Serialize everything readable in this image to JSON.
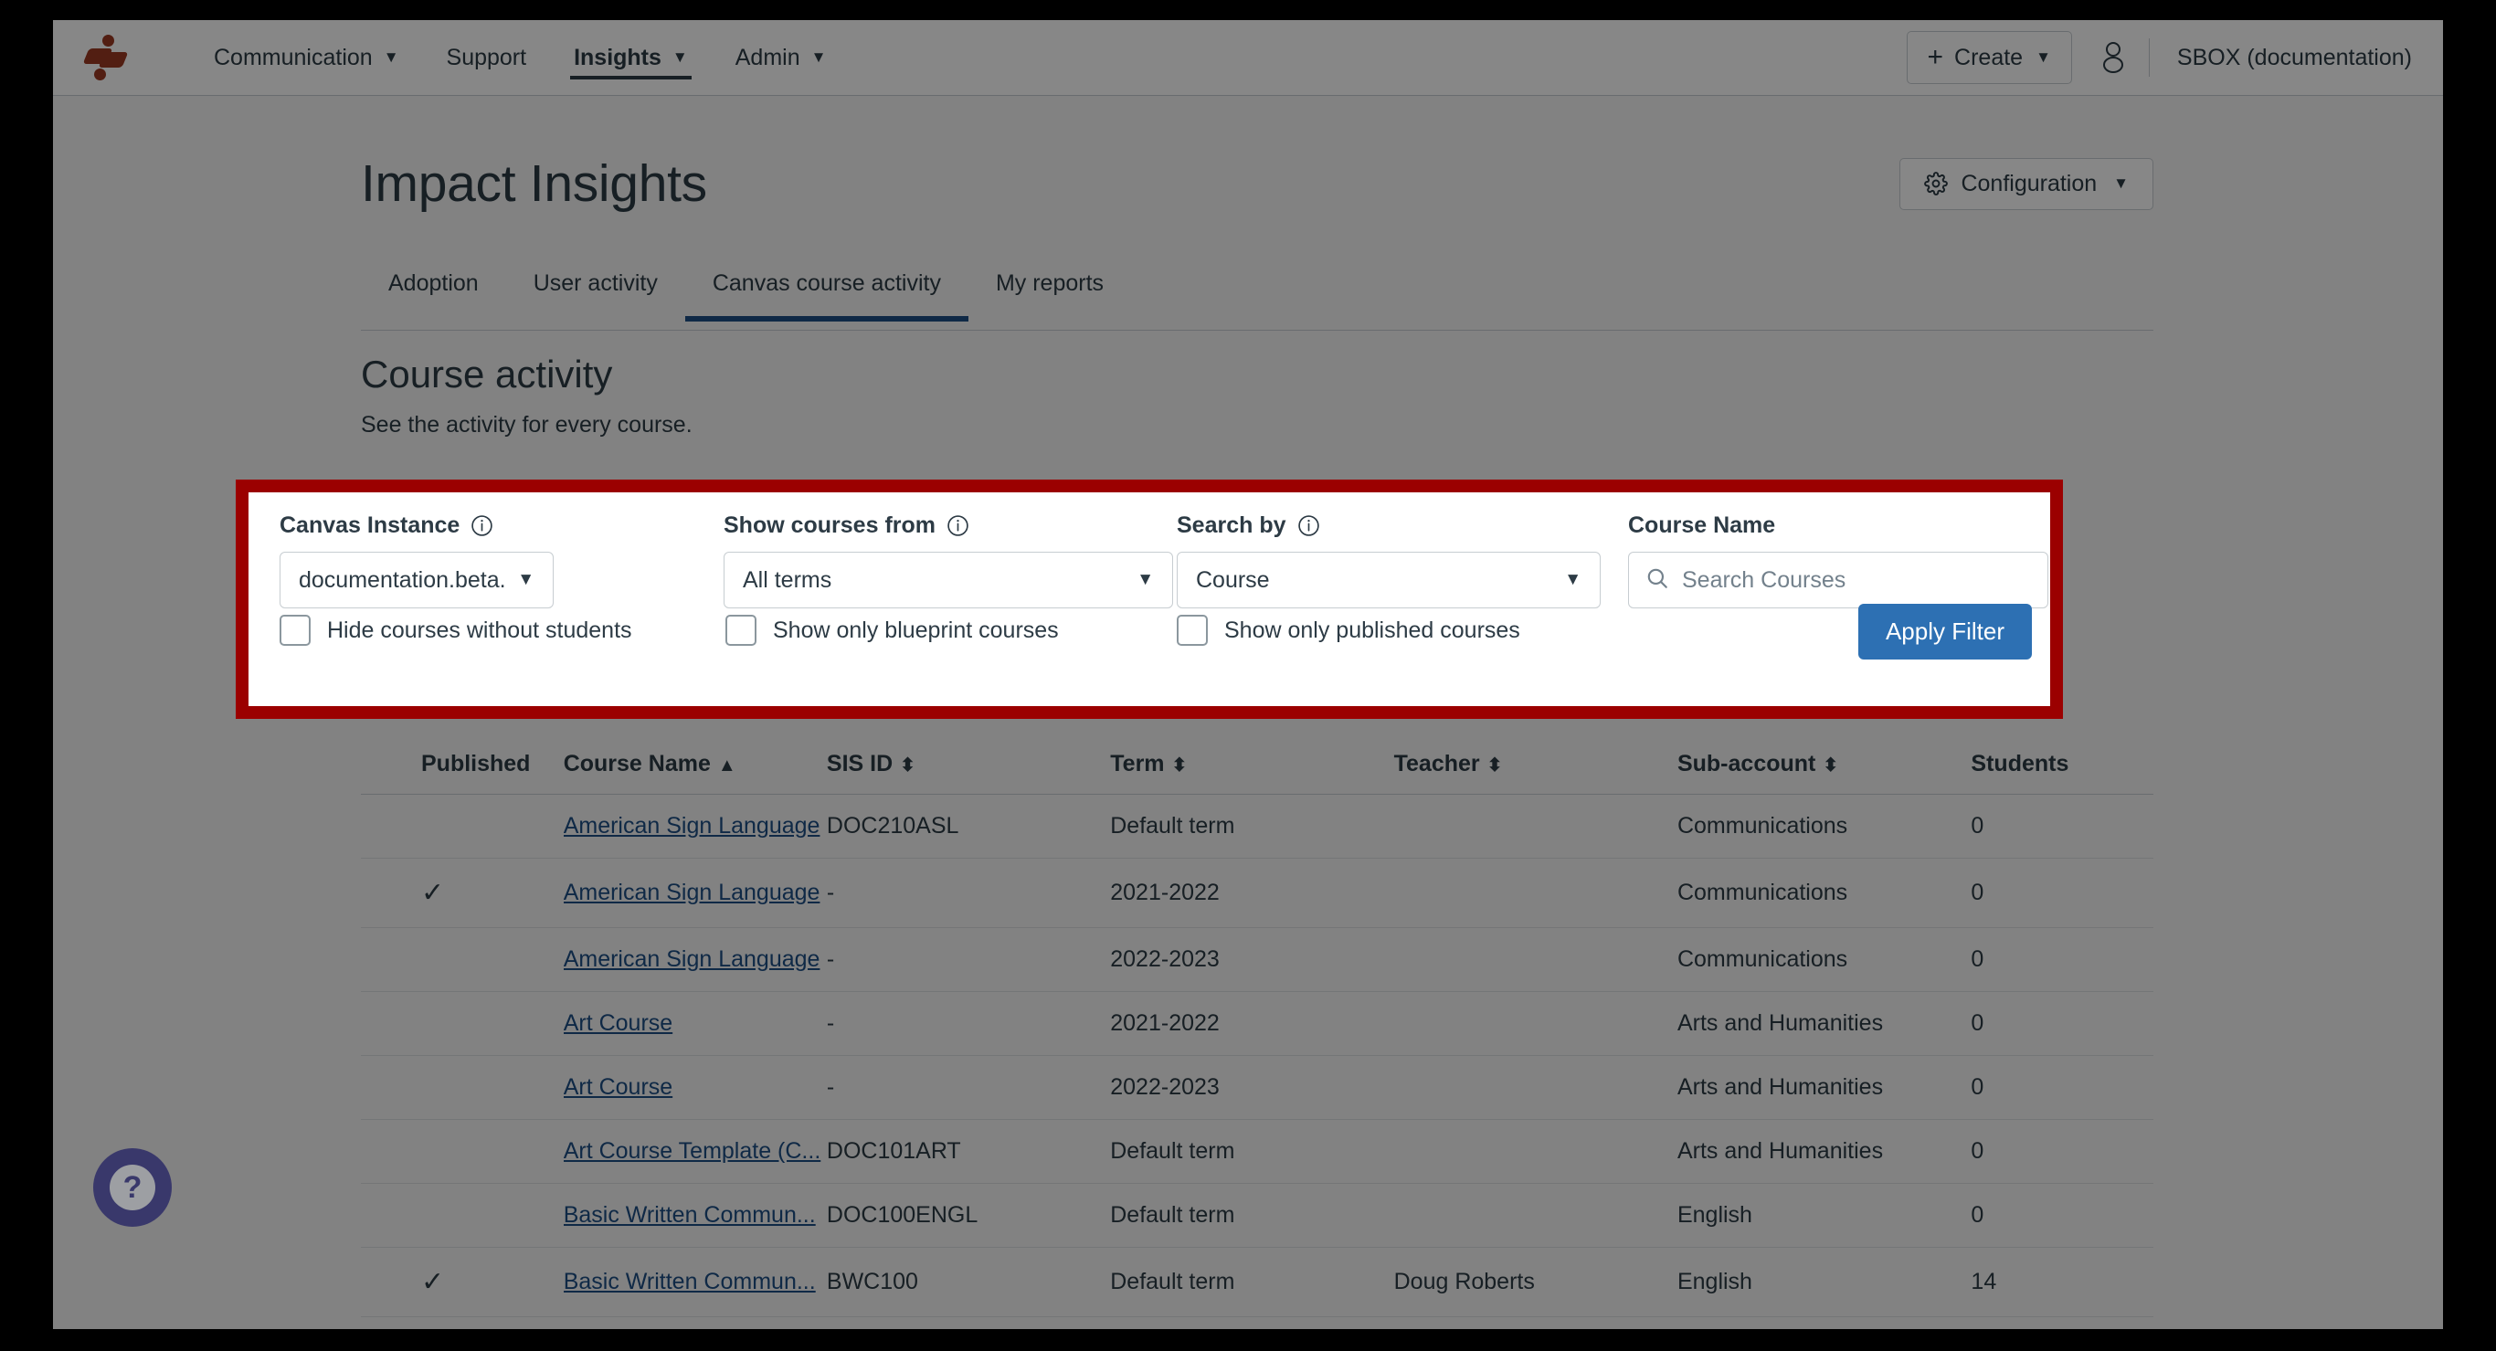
{
  "topnav": {
    "logo_name": "instructure-logo",
    "links": [
      {
        "label": "Communication",
        "has_caret": true,
        "active": false
      },
      {
        "label": "Support",
        "has_caret": false,
        "active": false
      },
      {
        "label": "Insights",
        "has_caret": true,
        "active": true
      },
      {
        "label": "Admin",
        "has_caret": true,
        "active": false
      }
    ],
    "create_label": "Create",
    "account_name": "SBOX (documentation)"
  },
  "header": {
    "title": "Impact Insights",
    "configuration_label": "Configuration"
  },
  "tabs": [
    {
      "label": "Adoption",
      "active": false
    },
    {
      "label": "User activity",
      "active": false
    },
    {
      "label": "Canvas course activity",
      "active": true
    },
    {
      "label": "My reports",
      "active": false
    }
  ],
  "section": {
    "title": "Course activity",
    "subtitle": "See the activity for every course."
  },
  "filters": {
    "canvas_instance": {
      "label": "Canvas Instance",
      "value": "documentation.beta.instructure"
    },
    "show_courses_from": {
      "label": "Show courses from",
      "value": "All terms"
    },
    "search_by": {
      "label": "Search by",
      "value": "Course"
    },
    "course_name": {
      "label": "Course Name",
      "placeholder": "Search Courses",
      "value": ""
    },
    "checkboxes": [
      {
        "label": "Hide courses without students",
        "checked": false
      },
      {
        "label": "Show only blueprint courses",
        "checked": false
      },
      {
        "label": "Show only published courses",
        "checked": false
      }
    ],
    "apply_label": "Apply Filter",
    "highlight_color": "#9b0000",
    "apply_color": "#2d70b3"
  },
  "table": {
    "columns": [
      {
        "label": "Published",
        "sort": ""
      },
      {
        "label": "Course Name",
        "sort": "▲"
      },
      {
        "label": "SIS ID",
        "sort": "⬍"
      },
      {
        "label": "Term",
        "sort": "⬍"
      },
      {
        "label": "Teacher",
        "sort": "⬍"
      },
      {
        "label": "Sub-account",
        "sort": "⬍"
      },
      {
        "label": "Students",
        "sort": ""
      }
    ],
    "rows": [
      {
        "published": "",
        "course_name": "American Sign Language",
        "sis_id": "DOC210ASL",
        "term": "Default term",
        "teacher": "",
        "sub_account": "Communications",
        "students": "0"
      },
      {
        "published": "✓",
        "course_name": "American Sign Language",
        "sis_id": "-",
        "term": "2021-2022",
        "teacher": "",
        "sub_account": "Communications",
        "students": "0"
      },
      {
        "published": "",
        "course_name": "American Sign Language",
        "sis_id": "-",
        "term": "2022-2023",
        "teacher": "",
        "sub_account": "Communications",
        "students": "0"
      },
      {
        "published": "",
        "course_name": "Art Course",
        "sis_id": "-",
        "term": "2021-2022",
        "teacher": "",
        "sub_account": "Arts and Humanities",
        "students": "0"
      },
      {
        "published": "",
        "course_name": "Art Course",
        "sis_id": "-",
        "term": "2022-2023",
        "teacher": "",
        "sub_account": "Arts and Humanities",
        "students": "0"
      },
      {
        "published": "",
        "course_name": "Art Course Template (C...",
        "sis_id": "DOC101ART",
        "term": "Default term",
        "teacher": "",
        "sub_account": "Arts and Humanities",
        "students": "0"
      },
      {
        "published": "",
        "course_name": "Basic Written Commun...",
        "sis_id": "DOC100ENGL",
        "term": "Default term",
        "teacher": "",
        "sub_account": "English",
        "students": "0"
      },
      {
        "published": "✓",
        "course_name": "Basic Written Commun...",
        "sis_id": "BWC100",
        "term": "Default term",
        "teacher": "Doug Roberts",
        "sub_account": "English",
        "students": "14"
      }
    ]
  },
  "help": {
    "label": "?"
  }
}
